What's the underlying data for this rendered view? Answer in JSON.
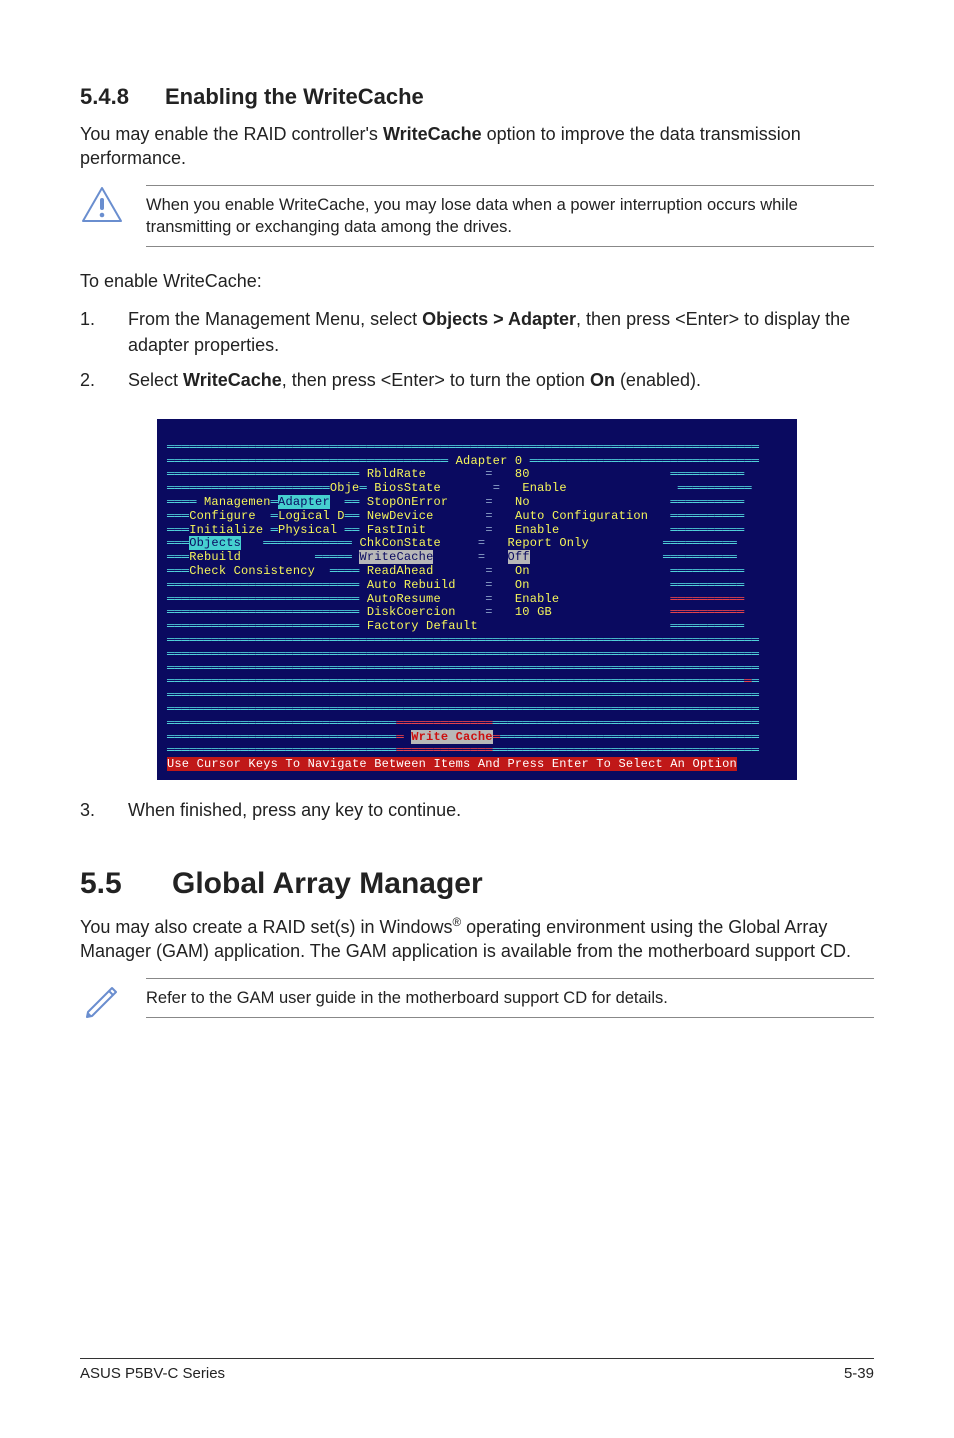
{
  "section1": {
    "number": "5.4.8",
    "title": "Enabling the WriteCache",
    "intro_pre": "You may enable the RAID controller's ",
    "intro_bold": "WriteCache",
    "intro_post": " option to improve the data transmission performance.",
    "warning": "When you enable WriteCache, you may lose data when a power interruption occurs while transmitting or exchanging data among the drives.",
    "enable_label": "To enable WriteCache:",
    "step1_pre": "From the Management Menu, select ",
    "step1_bold": "Objects > Adapter",
    "step1_post": ", then press <Enter> to display the adapter properties.",
    "step2_pre": "Select ",
    "step2_bold1": "WriteCache",
    "step2_mid": ", then press <Enter> to turn the option ",
    "step2_bold2": "On",
    "step2_post": " (enabled).",
    "step3": "When finished, press any key to continue."
  },
  "terminal": {
    "header_label": "Adapter 0",
    "left_menu": {
      "m1": "Managemen",
      "m2": "Configure",
      "m3": "Initialize",
      "m4": "Objects",
      "m5": "Rebuild",
      "m6": "Check Consistency"
    },
    "mid_menu": {
      "c1": "Obje",
      "c2": "Adapter",
      "c3": "Logical D",
      "c4": "Physical"
    },
    "props": {
      "p1": "RbldRate",
      "v1": "80",
      "p2": "BiosState",
      "v2": "Enable",
      "p3": "StopOnError",
      "v3": "No",
      "p4": "NewDevice",
      "v4": "Auto Configuration",
      "p5": "FastInit",
      "v5": "Enable",
      "p6": "ChkConState",
      "v6": "Report Only",
      "p7": "WriteCache",
      "v7": "Off",
      "p8": "ReadAhead",
      "v8": "On",
      "p9": "Auto Rebuild",
      "v9": "On",
      "p10": "AutoResume",
      "v10": "Enable",
      "p11": "DiskCoercion",
      "v11": "10 GB",
      "p12": "Factory Default"
    },
    "popup": "Write Cache",
    "statusbar": "Use Cursor Keys To Navigate Between Items And Press Enter To Select An Option"
  },
  "section2": {
    "number": "5.5",
    "title": "Global Array Manager",
    "body_pre": "You may also create a RAID set(s) in Windows",
    "body_sup": "®",
    "body_post": " operating environment using the Global Array Manager (GAM) application. The GAM application is available from the motherboard support CD.",
    "note": "Refer to the GAM user guide in the motherboard support CD for details."
  },
  "footer": {
    "left": "ASUS P5BV-C Series",
    "right": "5-39"
  }
}
